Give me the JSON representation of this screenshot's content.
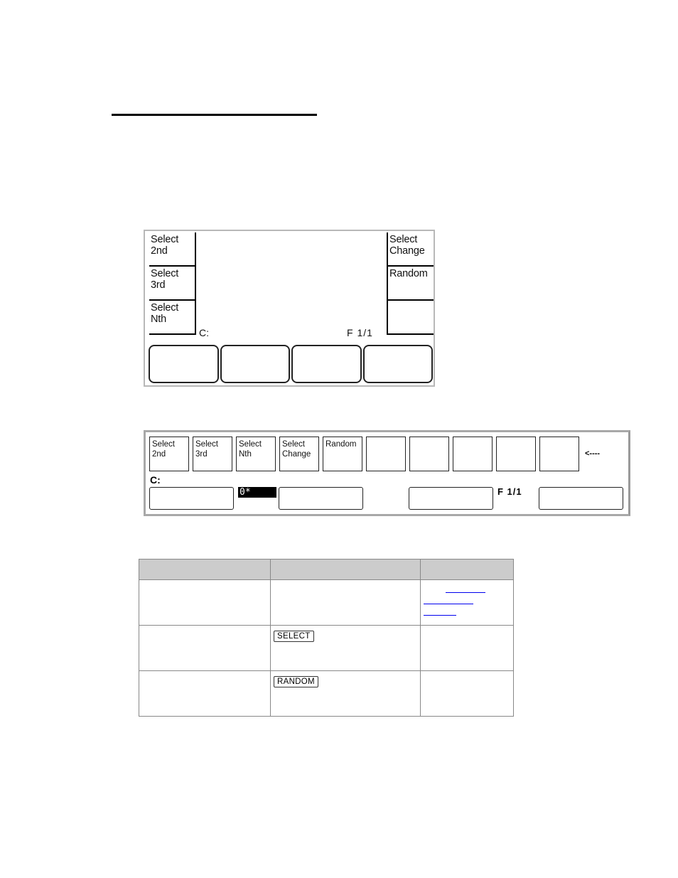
{
  "screen1": {
    "left_softkeys": [
      {
        "line1": "Select",
        "line2": "2nd"
      },
      {
        "line1": "Select",
        "line2": "3rd"
      },
      {
        "line1": "Select",
        "line2": "Nth"
      }
    ],
    "right_softkeys": [
      {
        "line1": "Select",
        "line2": "Change"
      },
      {
        "line1": "Random",
        "line2": ""
      },
      {
        "line1": "",
        "line2": ""
      }
    ],
    "command_label": "C:",
    "page_indicator": "F  1/1",
    "bottom_buttons": [
      "",
      "",
      "",
      ""
    ]
  },
  "screen2": {
    "softkeys": [
      {
        "line1": "Select",
        "line2": "2nd"
      },
      {
        "line1": "Select",
        "line2": "3rd"
      },
      {
        "line1": "Select",
        "line2": "Nth"
      },
      {
        "line1": "Select",
        "line2": "Change"
      },
      {
        "line1": "Random",
        "line2": ""
      },
      {
        "line1": "",
        "line2": ""
      },
      {
        "line1": "",
        "line2": ""
      },
      {
        "line1": "",
        "line2": ""
      },
      {
        "line1": "",
        "line2": ""
      },
      {
        "line1": "",
        "line2": ""
      }
    ],
    "arrow_label": "<----",
    "command_label": "C:",
    "highlight_value": "0*",
    "page_indicator": "F 1/1"
  },
  "table": {
    "headers": [
      "",
      "",
      ""
    ],
    "rows": [
      {
        "col1": "",
        "key": "",
        "col3": ""
      },
      {
        "col1": "",
        "key": "SELECT",
        "col3": ""
      },
      {
        "col1": "",
        "key": "RANDOM",
        "col3": ""
      }
    ],
    "link_color": "#0000ee"
  }
}
